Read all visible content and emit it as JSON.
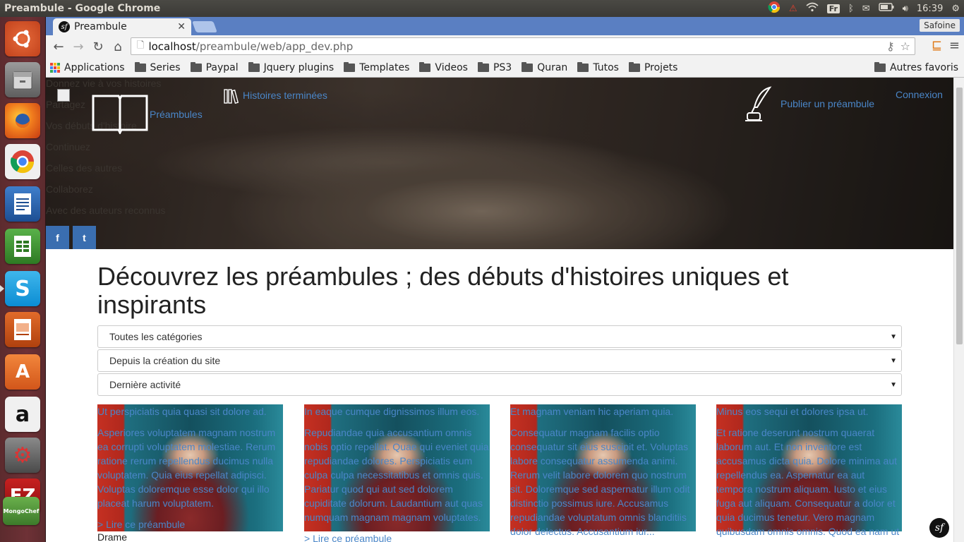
{
  "window": {
    "title": "Preambule - Google Chrome"
  },
  "tray": {
    "kbd_layout": "Fr",
    "clock": "16:39"
  },
  "browser": {
    "tab_title": "Preambule",
    "profile": "Safoine",
    "url_host": "localhost",
    "url_path": "/preambule/web/app_dev.php",
    "bookmarks": [
      "Applications",
      "Series",
      "Paypal",
      "Jquery plugins",
      "Templates",
      "Videos",
      "PS3",
      "Quran",
      "Tutos",
      "Projets"
    ],
    "other_bookmarks": "Autres favoris"
  },
  "hero": {
    "menu_items": [
      "Donnez vie à vos histoires",
      "Partagez",
      "Vos débuts d'histoire",
      "Continuez",
      "Celles des autres",
      "Collaborez",
      "Avec des auteurs reconnus"
    ],
    "nav_preambules": "Préambules",
    "nav_finished": "Histoires terminées",
    "nav_publish": "Publier un préambule",
    "nav_login": "Connexion",
    "facebook": "f",
    "twitter": "t"
  },
  "main": {
    "title": "Découvrez les préambules ; des débuts d'histoires uniques et inspirants",
    "filters": [
      {
        "selected": "Toutes les catégories"
      },
      {
        "selected": "Depuis la création du site"
      },
      {
        "selected": "Dernière activité"
      }
    ],
    "cards": [
      {
        "title": "Ut perspiciatis quia quasi sit dolore ad.",
        "excerpt": "Asperiores voluptatem magnam nostrum ea corrupti voluptatem molestiae. Rerum ratione rerum repellendus ducimus nulla voluptatem. Quia eius repellat adipisci. Voluptas doloremque esse dolor qui illo placeat harum voluptatem.",
        "link": "> Lire ce préambule",
        "category": "Drame"
      },
      {
        "title": "In eaque cumque dignissimos illum eos.",
        "excerpt": "Repudiandae quia accusantium omnis nobis optio repellat. Quae qui eveniet quia repudiandae dolores. Perspiciatis eum culpa culpa necessitatibus et omnis quis. Pariatur quod qui aut sed dolorem cupiditate dolorum. Laudantium aut quas numquam magnam magnam voluptates.",
        "link": "> Lire ce préambule",
        "category": ""
      },
      {
        "title": "Et magnam veniam hic aperiam quia.",
        "excerpt": "Consequatur magnam facilis optio consequatur sit eius suscipit et. Voluptas labore consequatur assumenda animi. Rerum velit labore dolorem quo nostrum sit. Doloremque sed aspernatur illum odit distinctio possimus iure. Accusamus repudiandae voluptatum omnis blanditiis dolor delectus. Accusantium iur...",
        "link": "",
        "category": ""
      },
      {
        "title": "Minus eos sequi et dolores ipsa ut.",
        "excerpt": "Et ratione deserunt nostrum quaerat laborum aut. Et non inventore est accusamus dicta quia. Dolore minima aut repellendus ea. Aspernatur ea aut tempora nostrum aliquam. Iusto et eius fuga aut aliquam. Consequatur a dolor et quia ducimus tenetur. Vero magnam quibusdam omnis omnis. Quod ea nam ut",
        "link": "",
        "category": ""
      }
    ]
  },
  "colors": {
    "link": "#4a86c8",
    "tabstrip": "#5a7fc2",
    "launcher": "#6e3136",
    "social": "#3a6eb0"
  },
  "icons": {
    "launcher": [
      "ubuntu-dash-icon",
      "files-icon",
      "firefox-icon",
      "chrome-icon",
      "writer-icon",
      "calc-icon",
      "skype-icon",
      "impress-icon",
      "software-center-icon",
      "amazon-icon",
      "system-settings-icon",
      "filezilla-icon"
    ]
  }
}
